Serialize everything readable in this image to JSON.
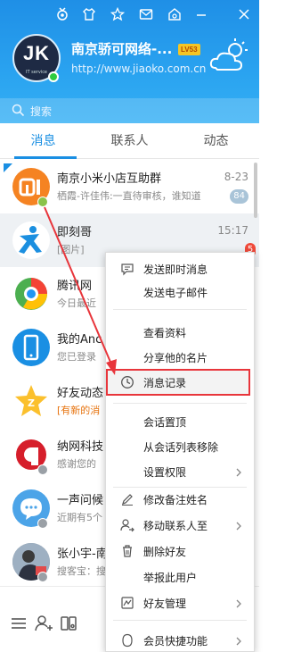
{
  "header": {
    "nickname": "南京骄可网络-...",
    "level": "LV53",
    "homepage": "http://www.jiaoko.com.cn",
    "avatar_text": "JK",
    "avatar_sub": "IT service",
    "search_placeholder": "搜索"
  },
  "tabs": [
    "消息",
    "联系人",
    "动态"
  ],
  "conversations": [
    {
      "name": "南京小米小店互助群",
      "preview": "栖霞-许佳伟:一直待审核，谁知道",
      "time": "8-23",
      "count": "84"
    },
    {
      "name": "即刻哥",
      "preview": "[图片]",
      "time": "15:17",
      "count": "5"
    },
    {
      "name": "腾讯网",
      "preview": "今日最近"
    },
    {
      "name": "我的Anc",
      "preview": "您已登录"
    },
    {
      "name": "好友动态",
      "preview": "[有新的消"
    },
    {
      "name": "纳网科技",
      "preview": "感谢您的"
    },
    {
      "name": "一声问候",
      "preview": "近期有5个"
    },
    {
      "name": "张小宇-南",
      "preview": "搜客宝：搜"
    }
  ],
  "context_menu": {
    "send_im": "发送即时消息",
    "send_email": "发送电子邮件",
    "view_profile": "查看资料",
    "share_card": "分享他的名片",
    "msg_history": "消息记录",
    "pin_session": "会话置顶",
    "remove_session": "从会话列表移除",
    "permissions": "设置权限",
    "edit_remark": "修改备注姓名",
    "move_contact": "移动联系人至",
    "delete_friend": "删除好友",
    "report_user": "举报此用户",
    "friend_mgmt": "好友管理",
    "vip_shortcuts": "会员快捷功能"
  },
  "colors": {
    "header_blue": "#2196ee",
    "accent": "#1a8fe3",
    "highlight_box": "#e8353b",
    "badge_red": "#f04a3a"
  }
}
